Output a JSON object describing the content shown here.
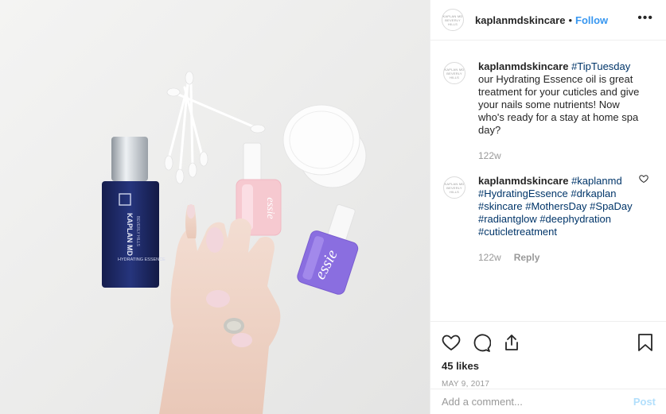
{
  "post": {
    "username": "kaplanmdskincare",
    "follow_label": "Follow",
    "dot": "•",
    "more_label": "•••",
    "avatar_text": "KAPLAN MD\nBEVERLY HILLS"
  },
  "photo": {
    "bottle_brand": "KAPLAN MD",
    "bottle_sub": "BEVERLY HILLS",
    "bottle_product": "HYDRATING ESSENCE",
    "polish_brand": "essie"
  },
  "comments": [
    {
      "username": "kaplanmdskincare",
      "hashtag": "#TipTuesday",
      "text": " our Hydrating Essence oil is great treatment for your cuticles and give your nails some nutrients! Now who's ready for a stay at home spa day?",
      "time": "122w"
    },
    {
      "username": "kaplanmdskincare",
      "hashtags": "#kaplanmd #HydratingEssence #drkaplan #skincare #MothersDay #SpaDay #radiantglow #deephydration #cuticletreatment",
      "time": "122w",
      "reply_label": "Reply"
    }
  ],
  "actions": {
    "likes": "45 likes",
    "date": "MAY 9, 2017"
  },
  "add_comment": {
    "placeholder": "Add a comment...",
    "post_label": "Post"
  },
  "colors": {
    "accent": "#3897f0",
    "hashtag": "#003569",
    "post_disabled": "#b2dffc",
    "bottle": "#1f2d6e",
    "polish_pink": "#f6c9d0",
    "polish_purple": "#8a6ee0"
  }
}
